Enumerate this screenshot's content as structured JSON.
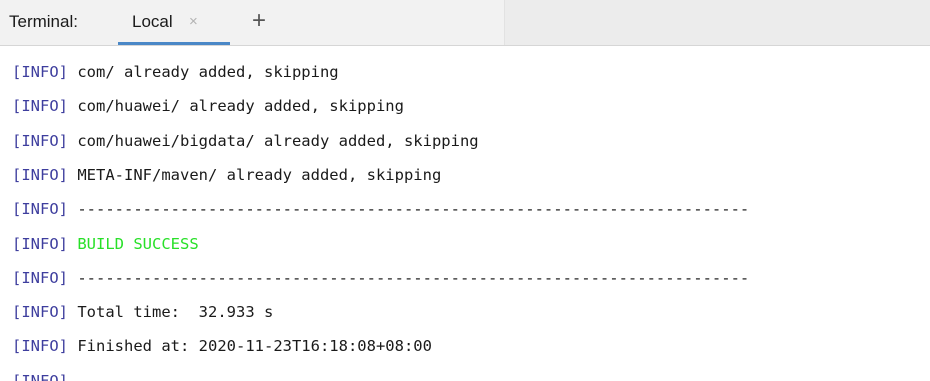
{
  "tabbar": {
    "title": "Terminal:",
    "tab_label": "Local",
    "tab_close": "×",
    "add_tab": "+"
  },
  "colors": {
    "info_tag": "#3e3e9e",
    "success": "#28e028",
    "tab_underline": "#4a88c7",
    "text": "#1a1a1a"
  },
  "output": {
    "tag_open": "[",
    "tag_word": "INFO",
    "tag_close": "]",
    "lines": [
      {
        "text": " com/ already added, skipping",
        "kind": "normal"
      },
      {
        "text": " com/huawei/ already added, skipping",
        "kind": "normal"
      },
      {
        "text": " com/huawei/bigdata/ already added, skipping",
        "kind": "normal"
      },
      {
        "text": " META-INF/maven/ already added, skipping",
        "kind": "normal"
      },
      {
        "text": " ------------------------------------------------------------------------",
        "kind": "normal"
      },
      {
        "text": " BUILD SUCCESS",
        "kind": "success"
      },
      {
        "text": " ------------------------------------------------------------------------",
        "kind": "normal"
      },
      {
        "text": " Total time:  32.933 s",
        "kind": "normal"
      },
      {
        "text": " Finished at: 2020-11-23T16:18:08+08:00",
        "kind": "normal"
      },
      {
        "text": " ------------------------------------------------------------------------",
        "kind": "normal"
      }
    ]
  }
}
